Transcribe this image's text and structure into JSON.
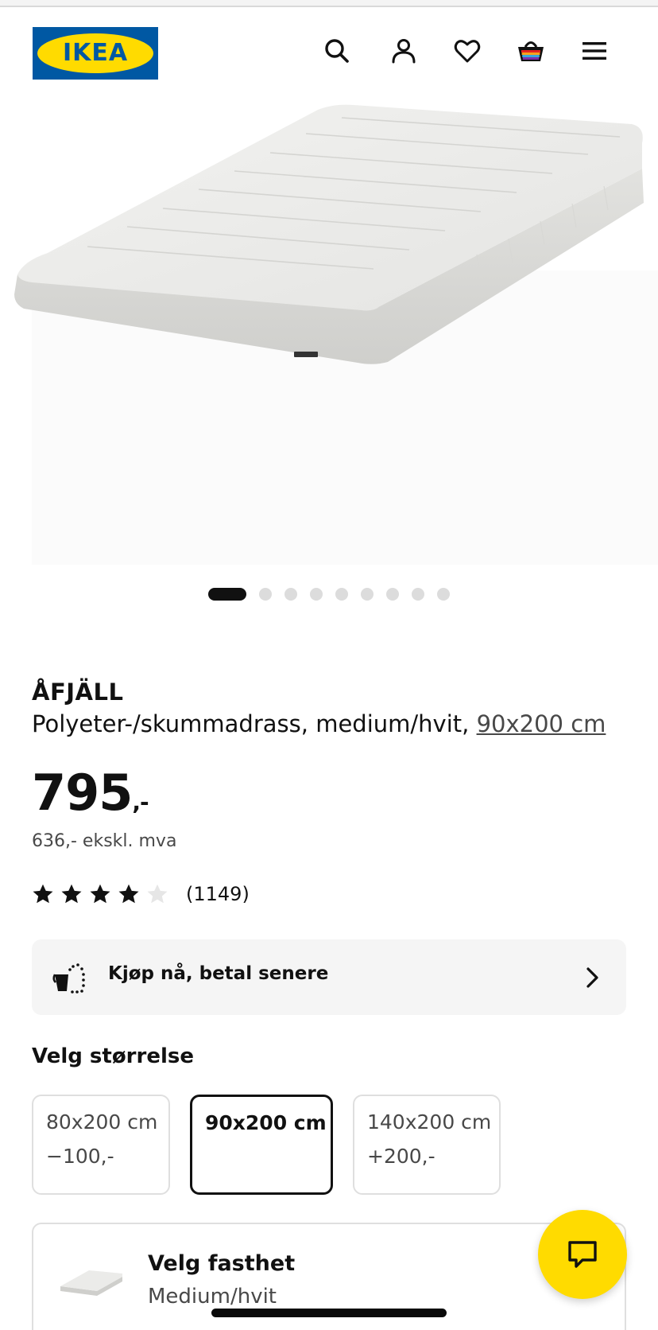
{
  "header": {
    "logo_text": "IKEA",
    "logo_reg": "®",
    "icons": [
      "search-icon",
      "account-icon",
      "heart-icon",
      "basket-icon",
      "menu-icon"
    ]
  },
  "gallery": {
    "image_count": 9,
    "active_index": 0
  },
  "product": {
    "name": "ÅFJÄLL",
    "description_prefix": "Polyeter-/skummadrass, medium/hvit, ",
    "description_size": "90x200 cm",
    "price": "795",
    "price_suffix": ",-",
    "price_ex_vat": "636,- ekskl. mva",
    "rating_value": 4,
    "rating_max": 5,
    "rating_count": "(1149)"
  },
  "paylater": {
    "label": "Kjøp nå, betal senere"
  },
  "size": {
    "heading": "Velg størrelse",
    "options": [
      {
        "label": "80x200 cm",
        "diff": "−100,-",
        "selected": false
      },
      {
        "label": "90x200 cm",
        "diff": "",
        "selected": true
      },
      {
        "label": "140x200 cm",
        "diff": "+200,-",
        "selected": false
      }
    ]
  },
  "firmness": {
    "title": "Velg fasthet",
    "value": "Medium/hvit"
  },
  "colors": {
    "brand_blue": "#0058a3",
    "brand_yellow": "#ffdb00",
    "text": "#111111",
    "muted": "#484848"
  }
}
